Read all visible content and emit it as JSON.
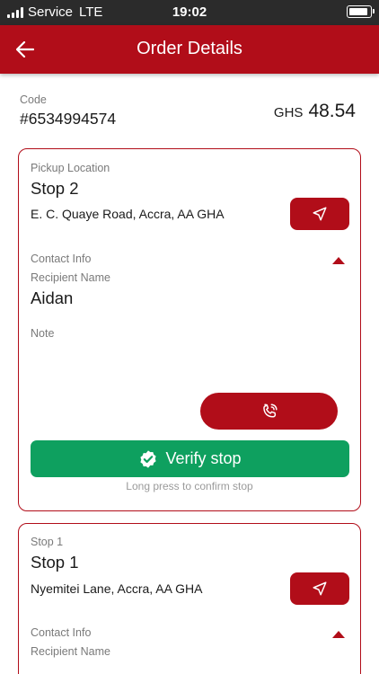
{
  "status_bar": {
    "carrier": "Service",
    "network": "LTE",
    "time": "19:02",
    "battery_level": 0.9
  },
  "app_bar": {
    "title": "Order Details"
  },
  "order": {
    "code_label": "Code",
    "code": "#6534994574",
    "currency": "GHS",
    "amount": "48.54"
  },
  "stops": [
    {
      "type_label": "Pickup Location",
      "name": "Stop 2",
      "address": "E. C. Quaye Road, Accra, AA GHA",
      "contact_label": "Contact Info",
      "recipient_label": "Recipient Name",
      "recipient": "Aidan",
      "note_label": "Note",
      "verify_label": "Verify stop",
      "verify_hint": "Long press to confirm stop"
    },
    {
      "type_label": "Stop 1",
      "name": "Stop 1",
      "address": "Nyemitei Lane, Accra, AA GHA",
      "contact_label": "Contact Info",
      "recipient_label": "Recipient Name"
    }
  ],
  "icons": {
    "back": "arrow-left-icon",
    "navigate": "navigation-arrow-icon",
    "call": "phone-call-icon",
    "verify": "check-badge-icon",
    "collapse": "caret-up-icon"
  },
  "colors": {
    "brand": "#b10d19",
    "success": "#0ea05f",
    "status_bar": "#2b2b2b"
  }
}
